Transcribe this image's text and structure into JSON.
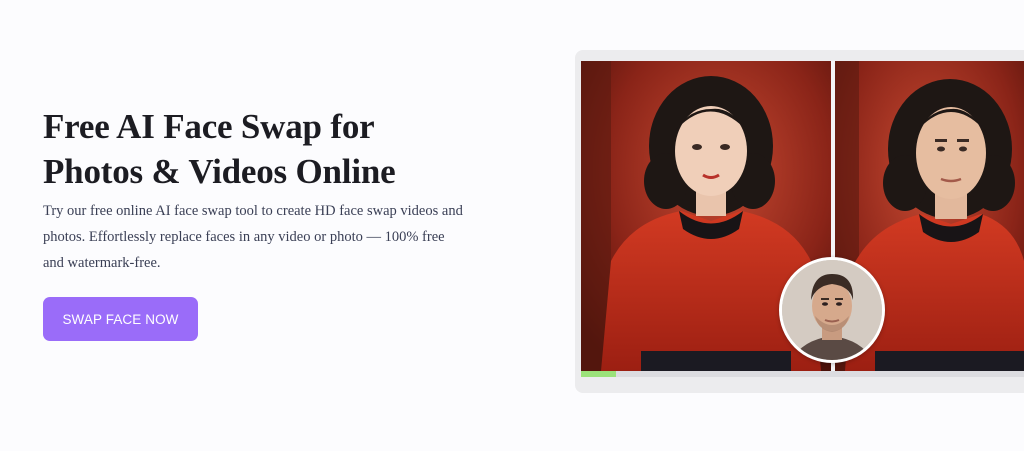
{
  "hero": {
    "title": "Free AI Face Swap for Photos & Videos Online",
    "description": "Try our free online AI face swap tool to create HD face swap videos and photos. Effortlessly replace faces in any video or photo — 100% free and watermark-free.",
    "cta_label": "SWAP FACE NOW"
  },
  "preview": {
    "before_image": "woman-portrait-red-dress",
    "after_image": "swapped-man-face-red-dress",
    "source_face": "man-face-portrait",
    "progress": 0.08
  },
  "colors": {
    "accent": "#9a6cf9",
    "title": "#1c1c22",
    "body_text": "#3a3f55",
    "progress": "#9be27a"
  }
}
